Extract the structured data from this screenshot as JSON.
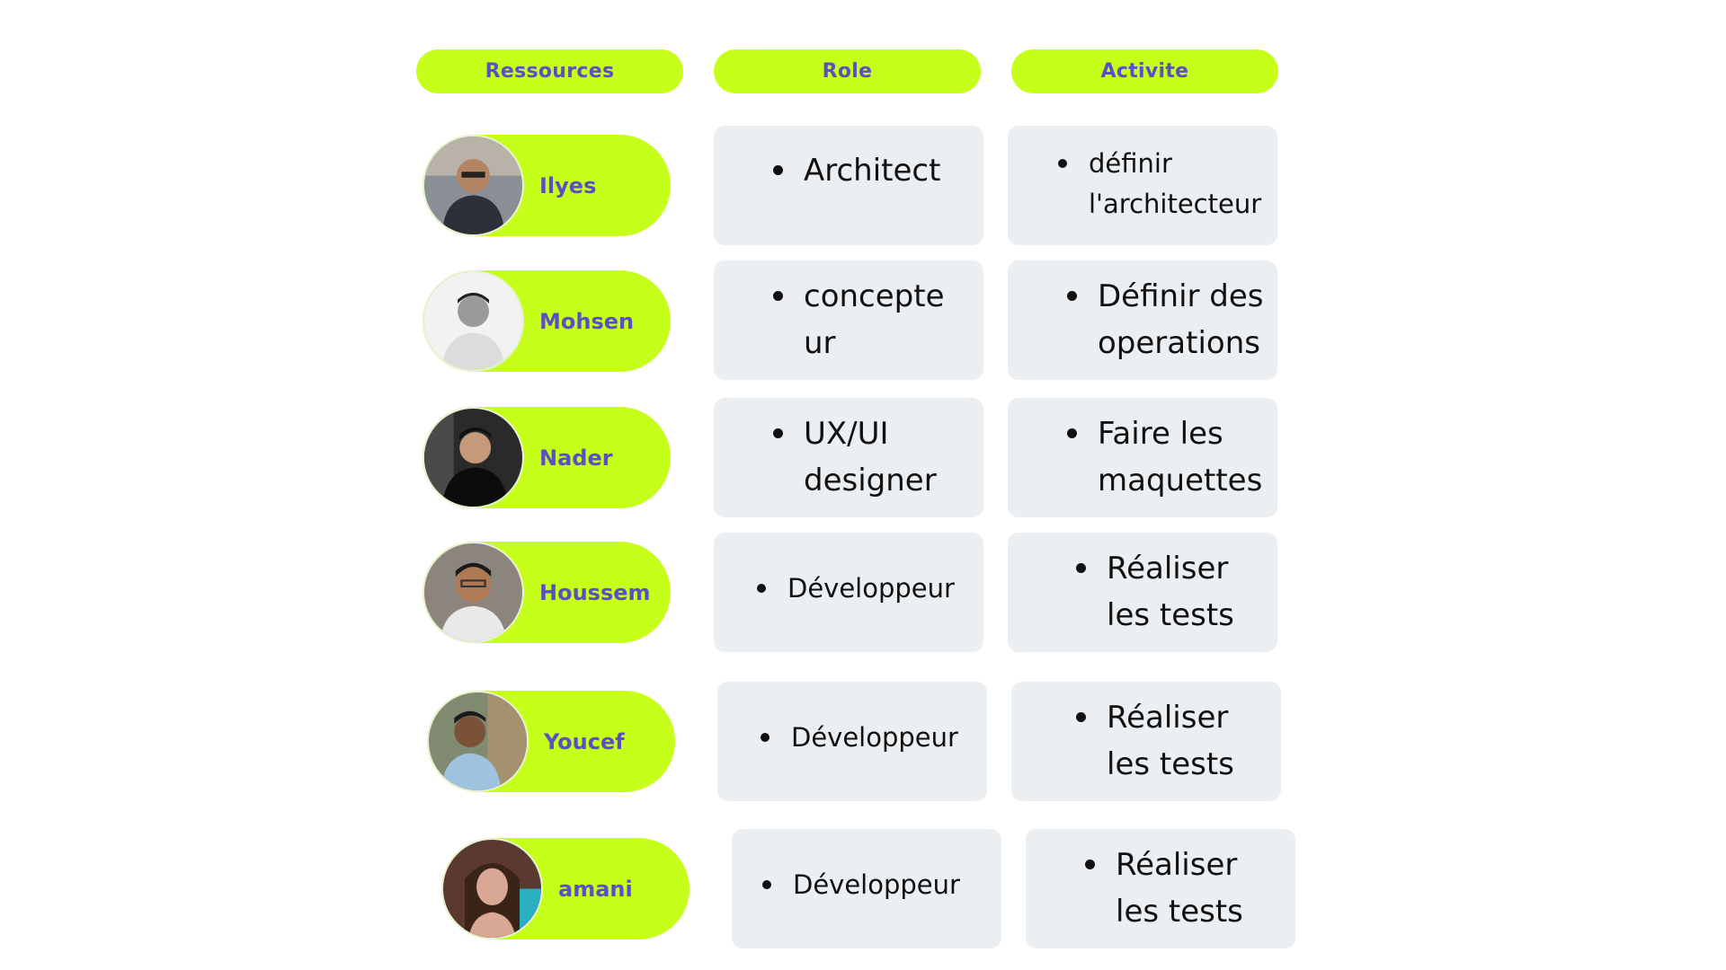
{
  "headers": {
    "ressources": "Ressources",
    "role": "Role",
    "activite": "Activite"
  },
  "rows": [
    {
      "name": "Ilyes",
      "role": "Architect",
      "role2": "",
      "activity": "définir",
      "activity2": "l'architecteur"
    },
    {
      "name": "Mohsen",
      "role": "concepte",
      "role2": "ur",
      "activity": "Définir des",
      "activity2": "operations"
    },
    {
      "name": "Nader",
      "role": "UX/UI",
      "role2": "designer",
      "activity": "Faire les",
      "activity2": "maquettes"
    },
    {
      "name": "Houssem",
      "role": "Développeur",
      "role2": "",
      "activity": "Réaliser",
      "activity2": "les tests"
    },
    {
      "name": "Youcef",
      "role": "Développeur",
      "role2": "",
      "activity": "Réaliser",
      "activity2": "les tests"
    },
    {
      "name": "amani",
      "role": "Développeur",
      "role2": "",
      "activity": "Réaliser",
      "activity2": "les tests"
    }
  ],
  "colors": {
    "accent": "#c6ff1a",
    "label": "#5b4fc4",
    "card": "#eceff2"
  }
}
